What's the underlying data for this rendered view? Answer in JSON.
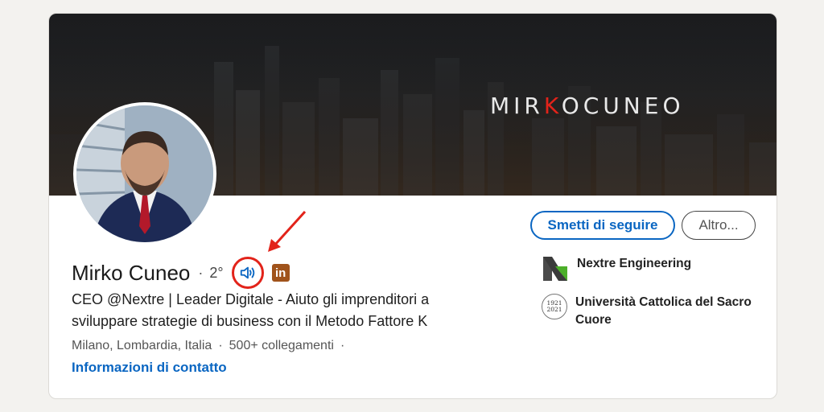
{
  "banner": {
    "brand_prefix": "MIR",
    "brand_accent": "K",
    "brand_suffix": "OCUNEO",
    "accent_color": "#e2231a"
  },
  "profile": {
    "name": "Mirko Cuneo",
    "separator": "·",
    "degree": "2°",
    "headline": "CEO @Nextre | Leader Digitale - Aiuto gli imprenditori a sviluppare strategie di business con il Metodo Fattore K",
    "location": "Milano, Lombardia, Italia",
    "meta_sep": "·",
    "connections": "500+ collegamenti",
    "meta_sep_end": "·",
    "contact_link": "Informazioni di contatto",
    "premium_badge": "in"
  },
  "actions": {
    "unfollow_label": "Smetti di seguire",
    "more_label": "Altro..."
  },
  "organizations": [
    {
      "name": "Nextre Engineering",
      "icon": "nextre-logo"
    },
    {
      "name": "Università Cattolica del Sacro Cuore",
      "icon": "university-seal",
      "seal_top": "1921",
      "seal_bottom": "2021"
    }
  ],
  "colors": {
    "link": "#0a66c2",
    "highlight": "#e2231a",
    "premium": "#a0531b"
  }
}
